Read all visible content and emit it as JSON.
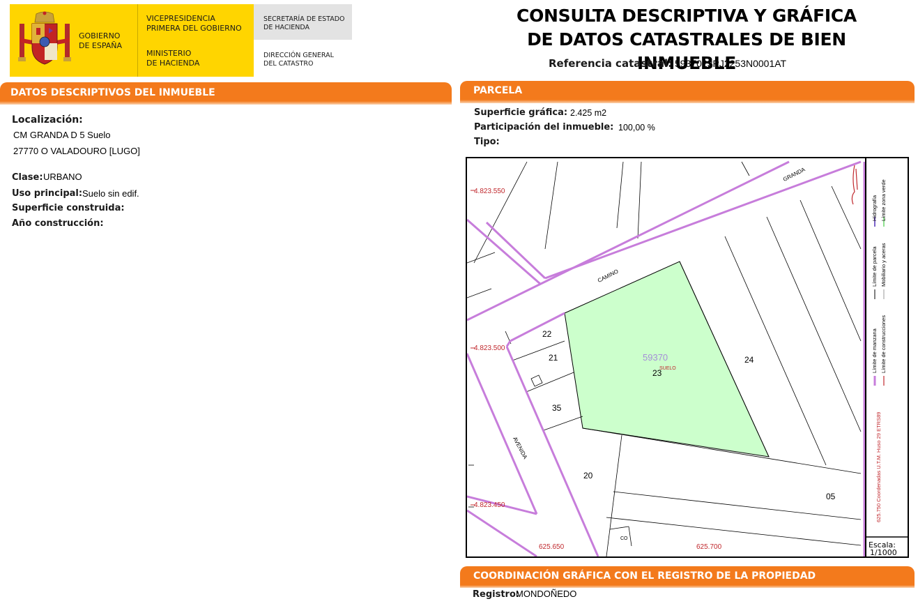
{
  "header": {
    "gov_name": "GOBIERNO\nDE ESPAÑA",
    "vicepresidencia": "VICEPRESIDENCIA\nPRIMERA DEL GOBIERNO",
    "ministerio": "MINISTERIO\nDE HACIENDA",
    "secretaria": "SECRETARÍA DE ESTADO\nDE HACIENDA",
    "direccion": "DIRECCIÓN GENERAL\nDEL CATASTRO",
    "title_line1": "CONSULTA DESCRIPTIVA Y GRÁFICA",
    "title_line2": "DE DATOS CATASTRALES DE BIEN INMUEBLE",
    "ref_label": "Referencia catastral:",
    "ref_value": "5937023PJ2253N0001AT"
  },
  "descriptivos": {
    "section_title": "DATOS DESCRIPTIVOS DEL INMUEBLE",
    "localizacion_label": "Localización:",
    "address_line1": "CM GRANDA D 5 Suelo",
    "address_line2": "27770 O VALADOURO [LUGO]",
    "clase_label": "Clase:",
    "clase_value": "URBANO",
    "uso_label": "Uso principal:",
    "uso_value": "Suelo sin edif.",
    "superficie_label": "Superficie construida:",
    "anio_label": "Año construcción:"
  },
  "parcela": {
    "section_title": "PARCELA",
    "superficie_label": "Superficie gráfica:",
    "superficie_value": "2.425 m2",
    "participacion_label": "Participación del inmueble:",
    "participacion_value": "100,00 %",
    "tipo_label": "Tipo:"
  },
  "map": {
    "coord_y1": "4.823.550",
    "coord_y2": "4.823.500",
    "coord_y3": "4.823.450",
    "coord_x1": "625.650",
    "coord_x2": "625.700",
    "street_granda": "GRANDA",
    "street_camino": "CAMINO",
    "street_avenida": "AVENIDA",
    "parcel_main": "59370",
    "parcel_use": "SUELO",
    "n22": "22",
    "n21": "21",
    "n23": "23",
    "n24": "24",
    "n35": "35",
    "n20": "20",
    "n05": "05",
    "nco": "CO",
    "legend_hidrografia": "Hidrografía",
    "legend_zona_verde": "Límite zona verde",
    "legend_parcela": "Límite de parcela",
    "legend_mobiliario": "Mobiliario y aceras",
    "legend_manzana": "Límite de manzana",
    "legend_construcciones": "Límite de construcciones",
    "legend_coords": "625.750 Coordenadas U.T.M. Huso 29 ETRS89",
    "escala_label": "Escala:",
    "escala_value": "1/1000",
    "colors": {
      "parcel_fill": "#ccffcc",
      "block_line": "#c77ddb",
      "coord_text": "#c0282d",
      "parcel_label": "#a58ed8"
    }
  },
  "coordinacion": {
    "section_title": "COORDINACIÓN GRÁFICA CON EL REGISTRO DE LA PROPIEDAD",
    "registro_label": "Registro:",
    "registro_value": "MONDOÑEDO"
  }
}
